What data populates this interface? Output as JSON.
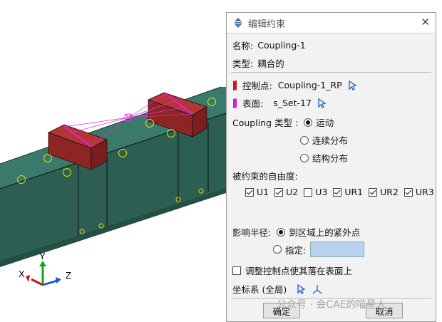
{
  "dialog": {
    "title": "编辑约束",
    "name_label": "名称:",
    "name_value": "Coupling-1",
    "type_label": "类型:",
    "type_value": "耦合的",
    "control_point_label": "控制点:",
    "control_point_value": "Coupling-1_RP",
    "surface_label": "表面:",
    "surface_value": "s_Set-17",
    "coupling_type_label": "Coupling 类型 :",
    "coupling_options": [
      "运动",
      "连续分布",
      "结构分布"
    ],
    "coupling_selected": 0,
    "dof_label": "被约束的自由度:",
    "dofs": [
      {
        "label": "U1",
        "checked": true
      },
      {
        "label": "U2",
        "checked": true
      },
      {
        "label": "U3",
        "checked": false
      },
      {
        "label": "UR1",
        "checked": true
      },
      {
        "label": "UR2",
        "checked": true
      },
      {
        "label": "UR3",
        "checked": true
      }
    ],
    "influence_label": "影响半径:",
    "influence_option1": "到区域上的紧外点",
    "influence_option2": "指定:",
    "influence_value": "",
    "adjust_label": "调整控制点使其落在表面上",
    "csys_label": "坐标系  (全局)",
    "ok_label": "确定",
    "cancel_label": "取消"
  },
  "triad": {
    "x": "X",
    "y": "Y",
    "z": "Z"
  },
  "watermark": "公众号 · 会CAE的喵星人",
  "colors": {
    "part": "#2e6b5e",
    "block": "#a52a2a",
    "surface": "#e020e0",
    "nodes": "#e0e000"
  }
}
